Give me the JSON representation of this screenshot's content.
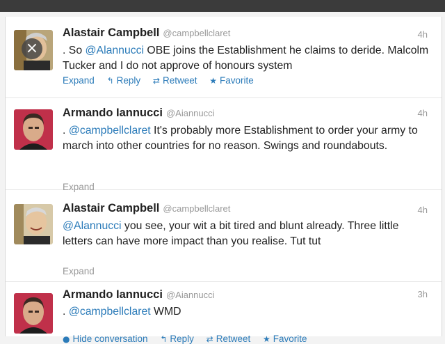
{
  "tweets": [
    {
      "name": "Alastair Campbell",
      "handle": "@campbellclaret",
      "time": "4h",
      "text_pre": ". So ",
      "mention": "@Alannucci",
      "text_post": " OBE joins the Establishment he claims to deride. Malcolm Tucker and I do not approve of honours system",
      "actions": {
        "expand": "Expand",
        "reply": "Reply",
        "retweet": "Retweet",
        "favorite": "Favorite"
      }
    },
    {
      "name": "Armando Iannucci",
      "handle": "@Aiannucci",
      "time": "4h",
      "text_pre": ". ",
      "mention": "@campbellclaret",
      "text_post": " It's probably more Establishment to order your army to march into other countries for no reason. Swings and roundabouts.",
      "actions": {
        "expand": "Expand"
      }
    },
    {
      "name": "Alastair Campbell",
      "handle": "@campbellclaret",
      "time": "4h",
      "text_pre": "",
      "mention": "@Alannucci",
      "text_post": " you see, your wit a bit tired and blunt already. Three little letters can have more impact than you realise. Tut tut",
      "actions": {
        "expand": "Expand"
      }
    },
    {
      "name": "Armando Iannucci",
      "handle": "@Aiannucci",
      "time": "3h",
      "text_pre": ". ",
      "mention": "@campbellclaret",
      "text_post": " WMD",
      "actions": {
        "hide": "Hide conversation",
        "reply": "Reply",
        "retweet": "Retweet",
        "favorite": "Favorite"
      }
    }
  ],
  "icons": {
    "close": "×",
    "reply": "↰",
    "retweet": "⇄",
    "favorite": "★",
    "conversation": "●"
  },
  "colors": {
    "link": "#2b7bb9",
    "muted": "#999999",
    "text": "#222222"
  }
}
